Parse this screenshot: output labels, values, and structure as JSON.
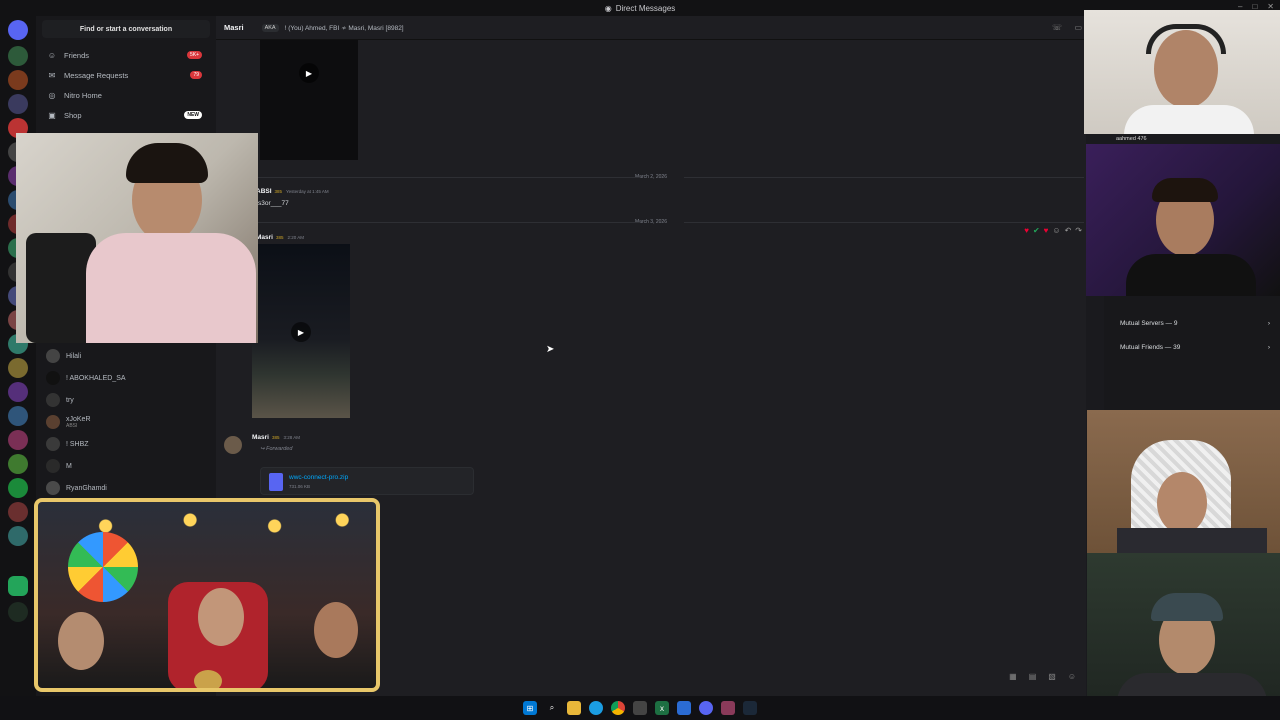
{
  "window": {
    "title": "Direct Messages"
  },
  "sidebar": {
    "search_placeholder": "Find or start a conversation",
    "nav": [
      {
        "label": "Friends",
        "badge": "5K+"
      },
      {
        "label": "Message Requests",
        "badge": "79"
      },
      {
        "label": "Nitro Home",
        "badge": ""
      },
      {
        "label": "Shop",
        "badge": "NEW"
      }
    ],
    "dms": [
      {
        "name": "Hilali",
        "sub": ""
      },
      {
        "name": "! ABOKHALED_SA",
        "sub": ""
      },
      {
        "name": "try",
        "sub": ""
      },
      {
        "name": "xJoKeR",
        "sub": "ABSI"
      },
      {
        "name": "! SHBZ",
        "sub": ""
      },
      {
        "name": "M",
        "sub": ""
      },
      {
        "name": "RyanGhamdi",
        "sub": ""
      }
    ]
  },
  "chat": {
    "header": {
      "name": "Masri",
      "aka_label": "AKA",
      "members": "! (You) Ahmed, FBI ≁ Masri, Masri [8982]"
    },
    "dates": [
      "March 2, 2026",
      "March 3, 2026"
    ],
    "messages": [
      {
        "author": "ABSI",
        "tag": "385",
        "time": "Yesterday at 1:45 AM",
        "text": "s3or___77"
      },
      {
        "author": "Masri",
        "tag": "385",
        "time": "2:20 AM",
        "text": ""
      },
      {
        "author": "Masri",
        "tag": "385",
        "time": "3:28 AM",
        "forwarded": "Forwarded",
        "file_name": "wwc-connect-pro.zip",
        "file_size": "731.06 KB"
      }
    ]
  },
  "profile": {
    "cam_label": "aahmed 476",
    "mutual_servers": "Mutual Servers — 9",
    "mutual_friends": "Mutual Friends — 39"
  },
  "colors": {
    "accent": "#5865f2",
    "danger": "#da373c",
    "link": "#00a8fc"
  }
}
